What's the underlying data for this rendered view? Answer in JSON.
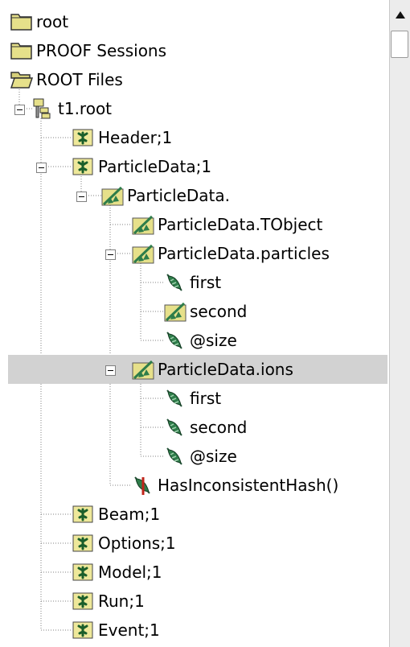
{
  "tree": {
    "rows": [
      {
        "label": "root",
        "icon": "folder-icon",
        "selected": false
      },
      {
        "label": "PROOF Sessions",
        "icon": "folder-icon",
        "selected": false
      },
      {
        "label": "ROOT Files",
        "icon": "folder-open-icon",
        "selected": false
      },
      {
        "label": "t1.root",
        "icon": "root-file-icon",
        "selected": false
      },
      {
        "label": "Header;1",
        "icon": "tree-icon",
        "selected": false
      },
      {
        "label": "ParticleData;1",
        "icon": "tree-icon",
        "selected": false
      },
      {
        "label": "ParticleData.",
        "icon": "branch-icon",
        "selected": false
      },
      {
        "label": "ParticleData.TObject",
        "icon": "branch-icon",
        "selected": false
      },
      {
        "label": "ParticleData.particles",
        "icon": "branch-icon",
        "selected": false
      },
      {
        "label": "first",
        "icon": "leaf-icon",
        "selected": false
      },
      {
        "label": "second",
        "icon": "branch-icon",
        "selected": false
      },
      {
        "label": "@size",
        "icon": "leaf-icon",
        "selected": false
      },
      {
        "label": "ParticleData.ions",
        "icon": "branch-icon",
        "selected": true
      },
      {
        "label": "first",
        "icon": "leaf-icon",
        "selected": false
      },
      {
        "label": "second",
        "icon": "leaf-icon",
        "selected": false
      },
      {
        "label": "@size",
        "icon": "leaf-icon",
        "selected": false
      },
      {
        "label": "HasInconsistentHash()",
        "icon": "method-icon",
        "selected": false
      },
      {
        "label": "Beam;1",
        "icon": "tree-icon",
        "selected": false
      },
      {
        "label": "Options;1",
        "icon": "tree-icon",
        "selected": false
      },
      {
        "label": "Model;1",
        "icon": "tree-icon",
        "selected": false
      },
      {
        "label": "Run;1",
        "icon": "tree-icon",
        "selected": false
      },
      {
        "label": "Event;1",
        "icon": "tree-icon",
        "selected": false
      }
    ]
  },
  "colors": {
    "selection": "#d2d2d2",
    "folder_fill": "#e6e08a",
    "leaf_green": "#2e7d4a",
    "dotted_line": "#808080"
  }
}
